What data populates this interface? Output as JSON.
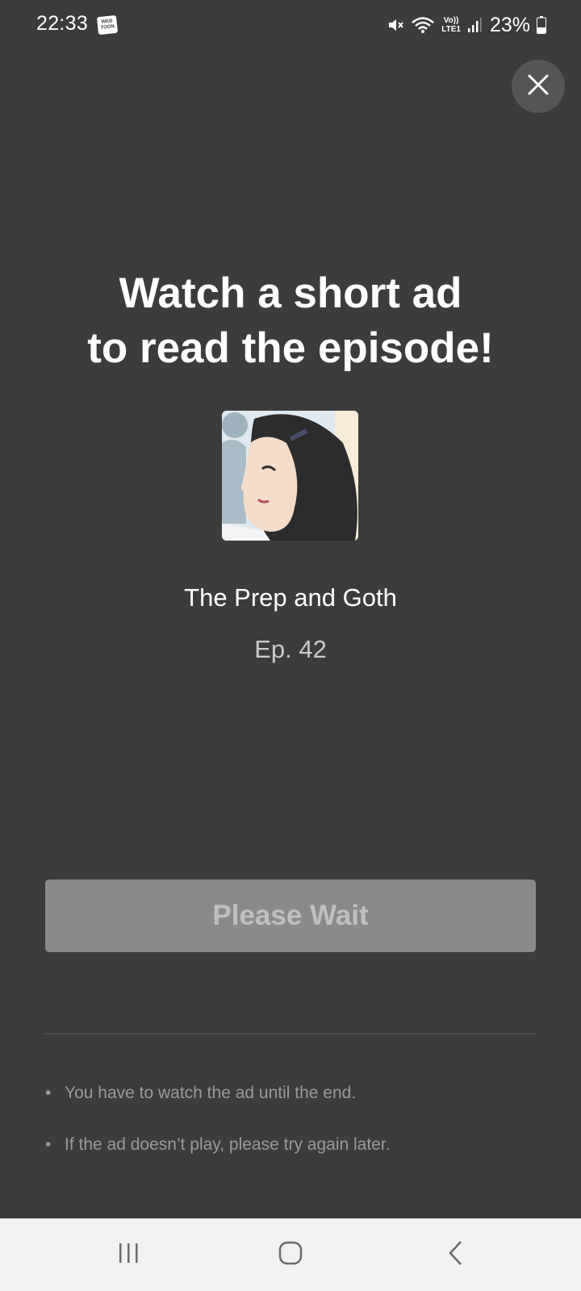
{
  "status_bar": {
    "time": "22:33",
    "app_badge_lines": [
      "WEB",
      "TOON"
    ],
    "signal_label_top": "Vo))",
    "signal_label_bottom": "LTE1",
    "battery": "23%",
    "icons": [
      "webtoon-notification-icon",
      "mute-icon",
      "wifi-icon",
      "volte-icon",
      "signal-icon",
      "battery-icon"
    ]
  },
  "header": {
    "close_icon": "close-icon"
  },
  "main": {
    "headline_line1": "Watch a short ad",
    "headline_line2": "to read the episode!",
    "series_title": "The Prep and Goth",
    "episode": "Ep. 42",
    "primary_button_label": "Please Wait",
    "notes": [
      "You have to watch the ad until the end.",
      "If the ad doesn’t play, please try again later."
    ]
  },
  "nav_bar": {
    "icons": [
      "recent-apps-icon",
      "home-icon",
      "back-icon"
    ]
  },
  "colors": {
    "background": "#3c3c3c",
    "button_disabled": "#8a8a8a",
    "button_text_disabled": "#bfbfbf",
    "nav_background": "#f1f1f1"
  }
}
